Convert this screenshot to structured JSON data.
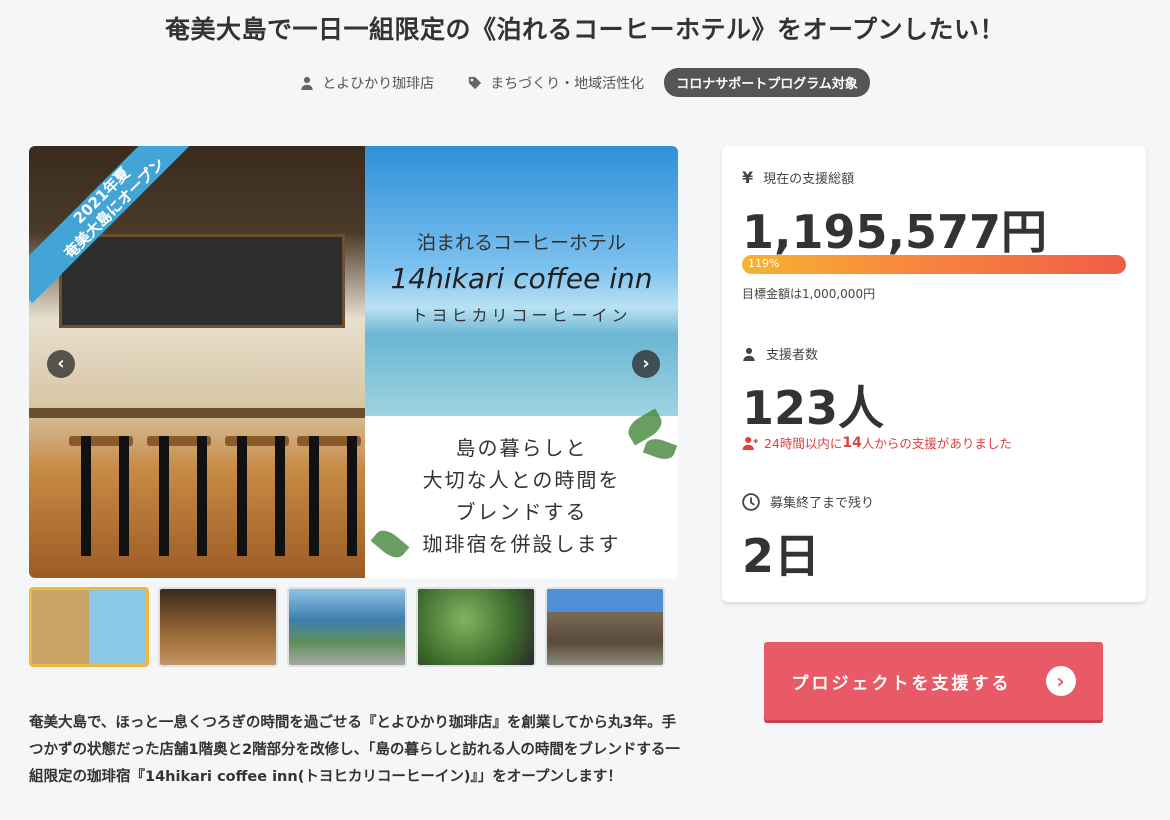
{
  "project": {
    "title": "奄美大島で一日一組限定の《泊れるコーヒーホテル》をオープンしたい！",
    "owner": "とよひかり珈琲店",
    "category": "まちづくり・地域活性化",
    "badge": "コロナサポートプログラム対象"
  },
  "hero": {
    "ribbon_line1": "2021年夏",
    "ribbon_line2": "奄美大島にオープン",
    "headline": "泊まれるコーヒーホテル",
    "name": "14hikari coffee inn",
    "kana": "トヨヒカリコーヒーイン",
    "tagline": [
      "島の暮らしと",
      "大切な人との時間を",
      "ブレンドする",
      "珈琲宿を併設します"
    ],
    "prev_label": "‹",
    "next_label": "›"
  },
  "thumbnails": [
    {
      "name": "thumb-1",
      "color": "#d9c9a0",
      "active": true
    },
    {
      "name": "thumb-2",
      "color": "#7a5230"
    },
    {
      "name": "thumb-3",
      "color": "#4a8fb8"
    },
    {
      "name": "thumb-4",
      "color": "#4c7a3a"
    },
    {
      "name": "thumb-5",
      "color": "#6a5a45"
    }
  ],
  "description": "奄美大島で、ほっと一息くつろぎの時間を過ごせる『とよひかり珈琲店』を創業してから丸3年。手つかずの状態だった店舗1階奥と2階部分を改修し、「島の暮らしと訪れる人の時間をブレンドする一組限定の珈琲宿『14hikari coffee inn(トヨヒカリコーヒーイン)』」をオープンします！",
  "stats": {
    "amount_label": "現在の支援総額",
    "amount_icon": "¥",
    "amount": "1,195,577円",
    "progress_percent": 119,
    "progress_label": "119%",
    "goal": "目標金額は1,000,000円",
    "backers_label": "支援者数",
    "backers": "123人",
    "recent_prefix": "24時間以内に",
    "recent_count": "14",
    "recent_suffix": "人からの支援がありました",
    "remaining_label": "募集終了まで残り",
    "remaining": "2日"
  },
  "cta": {
    "label": "プロジェクトを支援する",
    "arrow": "›",
    "color": "#e85a66"
  }
}
